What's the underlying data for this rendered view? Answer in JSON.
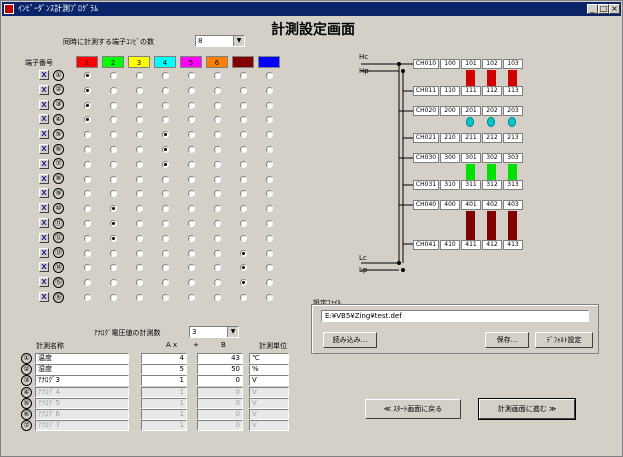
{
  "window": {
    "title": "ｲﾝﾋﾟｰﾀﾞﾝｽ計測ﾌﾟﾛｸﾞﾗﾑ"
  },
  "page_title": "計測設定画面",
  "simul": {
    "label": "同時に計測する端子ｺﾝﾋﾞの数",
    "value": "8"
  },
  "matrix": {
    "header_label": "端子番号",
    "headers": [
      {
        "text": "1",
        "color": "#ff0000"
      },
      {
        "text": "2",
        "color": "#00ff00"
      },
      {
        "text": "3",
        "color": "#ffff00"
      },
      {
        "text": "4",
        "color": "#00ffff"
      },
      {
        "text": "5",
        "color": "#ff00ff"
      },
      {
        "text": "6",
        "color": "#ff8000"
      },
      {
        "text": "",
        "color": "#800000"
      },
      {
        "text": "",
        "color": "#0000ff"
      }
    ],
    "rows": [
      {
        "x": "X",
        "num": "①",
        "sel": 0
      },
      {
        "x": "X",
        "num": "②",
        "sel": 0
      },
      {
        "x": "X",
        "num": "③",
        "sel": 0
      },
      {
        "x": "X",
        "num": "④",
        "sel": 0
      },
      {
        "x": "X",
        "num": "⑤",
        "sel": 3
      },
      {
        "x": "X",
        "num": "⑥",
        "sel": 3
      },
      {
        "x": "X",
        "num": "⑦",
        "sel": 3
      },
      {
        "x": "X",
        "num": "⑧",
        "sel": -1
      },
      {
        "x": "X",
        "num": "⑨",
        "sel": -1
      },
      {
        "x": "X",
        "num": "⑩",
        "sel": 1
      },
      {
        "x": "X",
        "num": "⑪",
        "sel": 1
      },
      {
        "x": "X",
        "num": "⑫",
        "sel": 1
      },
      {
        "x": "X",
        "num": "⑬",
        "sel": 6
      },
      {
        "x": "X",
        "num": "⑭",
        "sel": 6
      },
      {
        "x": "X",
        "num": "⑮",
        "sel": 6
      },
      {
        "x": "X",
        "num": "⑯",
        "sel": -1
      }
    ]
  },
  "analog": {
    "label": "ｱﾅﾛｸﾞ電圧値の計測数",
    "value": "3"
  },
  "meas_table": {
    "col_name": "計測名称",
    "col_a": "A x",
    "col_plus": "+",
    "col_b": "B",
    "col_unit": "計測単位",
    "rows": [
      {
        "num": "①",
        "name": "温度",
        "a": "4",
        "b": "43",
        "unit": "℃",
        "dim": false
      },
      {
        "num": "②",
        "name": "湿度",
        "a": "5",
        "b": "50",
        "unit": "%",
        "dim": false
      },
      {
        "num": "③",
        "name": "ｱﾅﾛｸﾞ3",
        "a": "1",
        "b": "0",
        "unit": "V",
        "dim": false
      },
      {
        "num": "④",
        "name": "ｱﾅﾛｸﾞ4",
        "a": "1",
        "b": "0",
        "unit": "V",
        "dim": true
      },
      {
        "num": "⑤",
        "name": "ｱﾅﾛｸﾞ5",
        "a": "1",
        "b": "0",
        "unit": "V",
        "dim": true
      },
      {
        "num": "⑥",
        "name": "ｱﾅﾛｸﾞ6",
        "a": "1",
        "b": "0",
        "unit": "V",
        "dim": true
      },
      {
        "num": "⑦",
        "name": "ｱﾅﾛｸﾞ7",
        "a": "1",
        "b": "0",
        "unit": "V",
        "dim": true
      }
    ]
  },
  "diagram": {
    "hc_label": "Hc",
    "hp_label": "Hp",
    "lc_label": "Lc",
    "lp_label": "Lp",
    "groups": [
      {
        "top": [
          "CH010",
          "100",
          "101",
          "102",
          "103"
        ],
        "bottom": [
          "CH011",
          "110",
          "111",
          "112",
          "113"
        ],
        "color": "#d00000",
        "kind": "block"
      },
      {
        "top": [
          "CH020",
          "200",
          "201",
          "202",
          "203"
        ],
        "bottom": [
          "CH021",
          "210",
          "211",
          "212",
          "213"
        ],
        "color": "#00c8d0",
        "kind": "pin"
      },
      {
        "top": [
          "CH030",
          "300",
          "301",
          "302",
          "303"
        ],
        "bottom": [
          "CH031",
          "310",
          "311",
          "312",
          "313"
        ],
        "color": "#00e000",
        "kind": "block"
      },
      {
        "top": [
          "CH040",
          "400",
          "401",
          "402",
          "403"
        ],
        "bottom": [
          "CH041",
          "410",
          "411",
          "412",
          "413"
        ],
        "color": "#800000",
        "kind": "block"
      }
    ]
  },
  "settings_file": {
    "label": "設定ﾌｧｲﾙ",
    "path": "E:¥VB5¥Zing¥test.def",
    "load": "読み込み...",
    "save": "保存...",
    "default": "ﾃﾞﾌｫﾙﾄ設定"
  },
  "nav": {
    "back": "≪ ｽﾀｰﾄ画面に戻る",
    "next": "計測画面に進む ≫"
  }
}
